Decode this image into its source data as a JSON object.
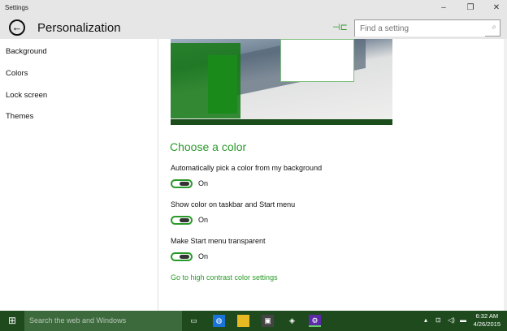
{
  "window": {
    "title": "Settings",
    "minimize": "–",
    "restore": "❐",
    "close": "✕"
  },
  "header": {
    "back_icon": "←",
    "title": "Personalization",
    "pin_icon": "⊣⊏",
    "search_placeholder": "Find a setting",
    "search_icon": "⌕"
  },
  "sidebar": {
    "items": [
      {
        "label": "Background"
      },
      {
        "label": "Colors"
      },
      {
        "label": "Lock screen"
      },
      {
        "label": "Themes"
      }
    ]
  },
  "main": {
    "heading": "Choose a color",
    "settings": [
      {
        "label": "Automatically pick a color from my background",
        "state": "On"
      },
      {
        "label": "Show color on taskbar and Start menu",
        "state": "On"
      },
      {
        "label": "Make Start menu transparent",
        "state": "On"
      }
    ],
    "link": "Go to high contrast color settings",
    "accent": "#2a9a2a"
  },
  "taskbar": {
    "search_placeholder": "Search the web and Windows",
    "time": "6:32 AM",
    "date": "4/26/2015"
  }
}
